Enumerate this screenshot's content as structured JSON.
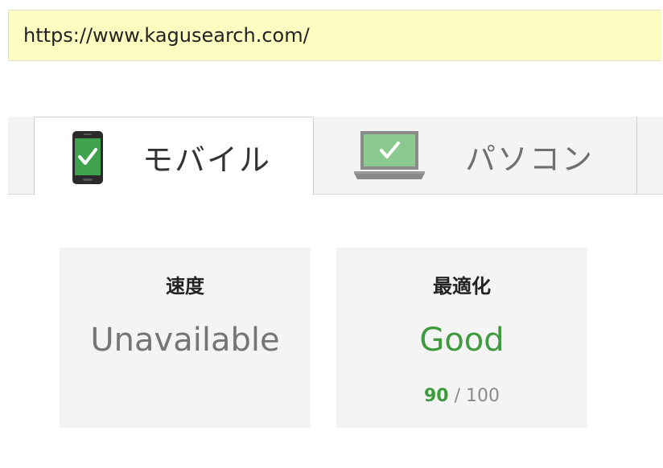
{
  "url_bar": {
    "value": "https://www.kagusearch.com/"
  },
  "tabs": [
    {
      "label": "モバイル",
      "icon": "mobile-phone-check-icon",
      "selected": true
    },
    {
      "label": "パソコン",
      "icon": "laptop-check-icon",
      "selected": false
    }
  ],
  "cards": {
    "speed": {
      "title": "速度",
      "value": "Unavailable"
    },
    "optimization": {
      "title": "最適化",
      "value": "Good",
      "score": "90",
      "score_separator": "/ 100"
    }
  },
  "colors": {
    "url_bar_bg": "#fdfdc1",
    "good_green": "#3d9a3d",
    "check_green": "#3fa34d",
    "card_bg": "#f4f4f4"
  }
}
